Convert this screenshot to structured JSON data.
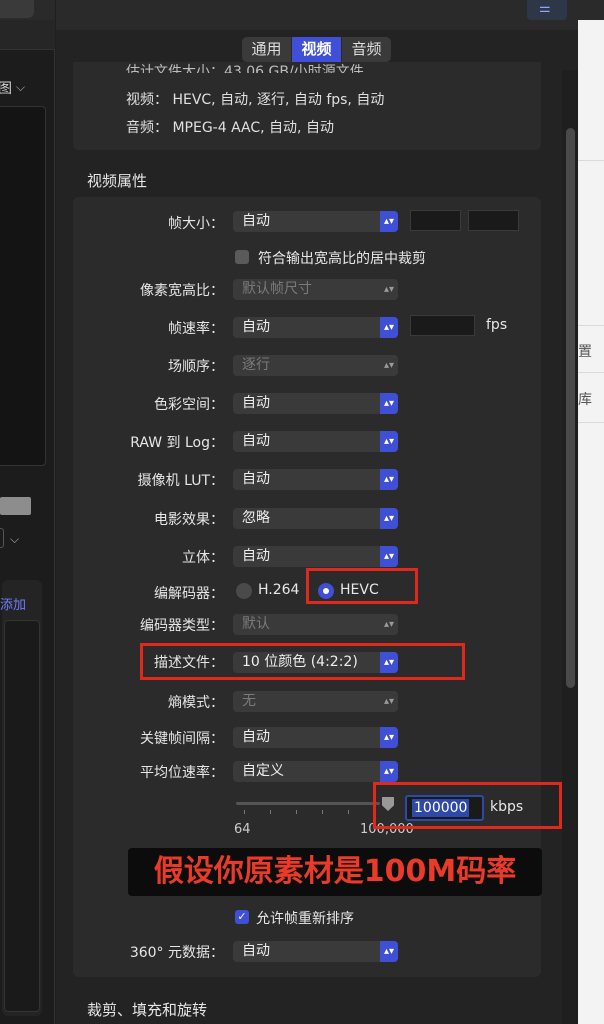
{
  "left_panel": {
    "view_label": "图",
    "add_label": "添加"
  },
  "tabs": [
    {
      "label": "通用",
      "active": false
    },
    {
      "label": "视频",
      "active": true
    },
    {
      "label": "音频",
      "active": false
    }
  ],
  "summary": {
    "line0": "估计文件大小：43.06 GB/小时源文件",
    "video": "视频：  HEVC, 自动, 逐行, 自动 fps, 自动",
    "audio": "音频：  MPEG-4 AAC, 自动, 自动"
  },
  "video_section": {
    "title": "视频属性",
    "frame_size": {
      "label": "帧大小：",
      "value": "自动"
    },
    "crop_checkbox": {
      "label": "符合输出宽高比的居中裁剪",
      "checked": false
    },
    "pixel_aspect": {
      "label": "像素宽高比：",
      "value": "默认帧尺寸"
    },
    "frame_rate": {
      "label": "帧速率：",
      "value": "自动",
      "unit": "fps"
    },
    "field_order": {
      "label": "场顺序：",
      "value": "逐行"
    },
    "color_space": {
      "label": "色彩空间：",
      "value": "自动"
    },
    "raw_to_log": {
      "label": "RAW 到 Log：",
      "value": "自动"
    },
    "camera_lut": {
      "label": "摄像机 LUT：",
      "value": "自动"
    },
    "film_effect": {
      "label": "电影效果：",
      "value": "忽略"
    },
    "stereo": {
      "label": "立体：",
      "value": "自动"
    },
    "codec": {
      "label": "编解码器：",
      "option_h264": "H.264",
      "option_hevc": "HEVC",
      "selected": "HEVC"
    },
    "encoder_type": {
      "label": "编码器类型：",
      "value": "默认"
    },
    "profile": {
      "label": "描述文件：",
      "value": "10 位颜色 (4:2:2)"
    },
    "entropy_mode": {
      "label": "熵模式：",
      "value": "无"
    },
    "keyframe_interval": {
      "label": "关键帧间隔：",
      "value": "自动"
    },
    "avg_bitrate": {
      "label": "平均位速率：",
      "value": "自定义"
    },
    "bitrate_slider": {
      "min_label": "64",
      "max_label": "100,000",
      "value": "100000",
      "unit": "kbps"
    },
    "annotation": "假设你原素材是100M码率",
    "reorder_checkbox": {
      "label": "允许帧重新排序",
      "checked": true
    },
    "metadata_360": {
      "label": "360° 元数据：",
      "value": "自动"
    }
  },
  "crop_section": {
    "title": "裁剪、填充和旋转"
  },
  "right_panel": {
    "text1": "置",
    "text2": "库"
  },
  "colors": {
    "accent": "#3f4fd6",
    "annotation_red": "#e0291d"
  }
}
